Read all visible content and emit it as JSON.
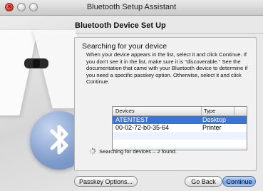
{
  "window": {
    "title": "Bluetooth Setup Assistant"
  },
  "header": {
    "title": "Bluetooth Device Set Up"
  },
  "panel": {
    "subtitle": "Searching for your device",
    "description": "When your device appears in the list, select it and click Continue. If you don't see it in the list, make sure it is \"discoverable.\" See the documentation that came with your Bluetooth device to determine if you need a specific passkey option. Otherwise, select it and click Continue."
  },
  "table": {
    "columns": [
      "Devices",
      "Type"
    ],
    "rows": [
      {
        "device": "ATENTEST",
        "type": "Desktop",
        "selected": true
      },
      {
        "device": "00-02-72-b0-35-64",
        "type": "Printer",
        "selected": false
      }
    ]
  },
  "status": "Searching for devices – 2 found.",
  "buttons": {
    "passkey": "Passkey Options...",
    "back": "Go Back",
    "continue": "Continue"
  },
  "colors": {
    "selection": "#3875d7",
    "default_button": "#6ea3ea"
  }
}
